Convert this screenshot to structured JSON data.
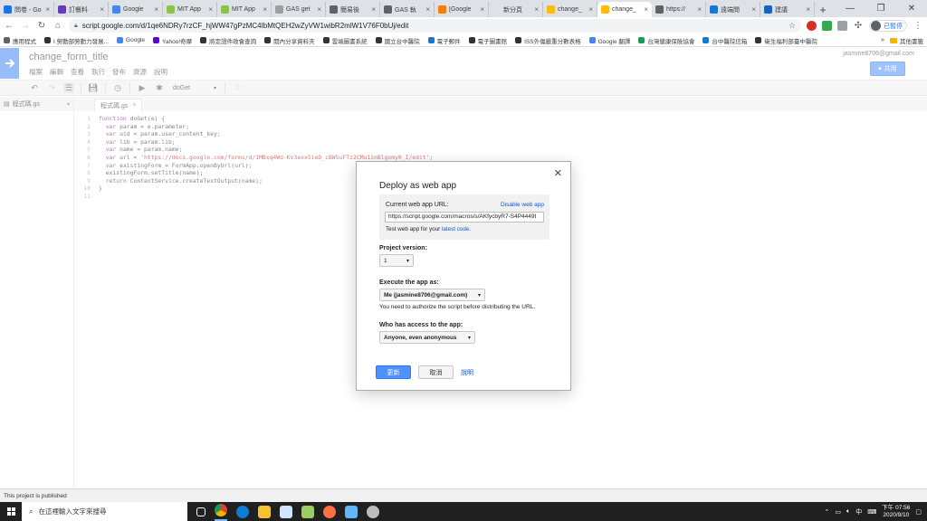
{
  "browser": {
    "tabs": [
      {
        "title": "問卷 - Go",
        "color": "#1a73e8"
      },
      {
        "title": "訂餐料",
        "color": "#673ab7"
      },
      {
        "title": "Google",
        "color": "#4285f4"
      },
      {
        "title": "MIT App",
        "color": "#8bc34a"
      },
      {
        "title": "MIT App",
        "color": "#8bc34a"
      },
      {
        "title": "GAS get",
        "color": "#9e9e9e"
      },
      {
        "title": "簡易後",
        "color": "#5f6368"
      },
      {
        "title": "GAS 執",
        "color": "#5f6368"
      },
      {
        "title": "[Google",
        "color": "#f57c00"
      },
      {
        "title": "新分頁",
        "color": "#dee1e6"
      },
      {
        "title": "change_",
        "color": "#fbbc04"
      },
      {
        "title": "change_",
        "color": "#fbbc04"
      },
      {
        "title": "https://",
        "color": "#5f6368"
      },
      {
        "title": "遠端問",
        "color": "#1976d2"
      },
      {
        "title": "建議",
        "color": "#1565c0"
      }
    ],
    "active_tab_index": 11,
    "url": "script.google.com/d/1qe6NDRy7rzCF_hjWW47gPzMC4IbMtQEH2wZyVW1wibR2mlW1V76F0bUj/edit",
    "profile_label": "已暫停",
    "bookmarks": [
      {
        "label": "應用程式",
        "color": "#5f6368"
      },
      {
        "label": "I 勞動部勞動力發展...",
        "color": "#333333"
      },
      {
        "label": "Google",
        "color": "#4285f4"
      },
      {
        "label": "Yahoo!奇摩",
        "color": "#6001d2"
      },
      {
        "label": "將定證件政會查詢",
        "color": "#333333"
      },
      {
        "label": "開內分享資料夾",
        "color": "#333333"
      },
      {
        "label": "雲端圖書系統",
        "color": "#333333"
      },
      {
        "label": "國立台中醫院",
        "color": "#333333"
      },
      {
        "label": "電子郵件",
        "color": "#1976d2"
      },
      {
        "label": "電子圖書館",
        "color": "#333333"
      },
      {
        "label": "ISS外傷嚴重分數表格",
        "color": "#333333"
      },
      {
        "label": "Google 翻譯",
        "color": "#4285f4"
      },
      {
        "label": "台灣健康保險協會",
        "color": "#0f9d58"
      },
      {
        "label": "台中醫院信箱",
        "color": "#1976d2"
      },
      {
        "label": "衛生福利部臺中醫院",
        "color": "#333333"
      }
    ],
    "bookmarks_more": "»",
    "other_bookmarks": "其他書籤"
  },
  "app": {
    "project_title": "change_form_title",
    "menu": [
      "檔案",
      "編輯",
      "查看",
      "執行",
      "發布",
      "資源",
      "說明"
    ],
    "user_email": "jasmine8706@gmail.com",
    "share_label": "共用",
    "function_select": "doGet",
    "file_name": "程式碼.gs",
    "editor_tab": "程式碼.gs",
    "status": "This project is published"
  },
  "code_lines": [
    "function doGet(e) {",
    "  var param = e.parameter;",
    "  var uid = param.user_content_key;",
    "  var lib = param.lib;",
    "  var name = param.name;",
    "  var url = 'https://docs.google.com/forms/d/1MBxq4Wd-Kv3exx5ieD_cBW5uFTz2CMu1inBlgxmy0_I/edit';",
    "  var existingForm = FormApp.openByUrl(url);",
    "  existingForm.setTitle(name);",
    "  return ContentService.createTextOutput(name);",
    "}",
    ""
  ],
  "dialog": {
    "title": "Deploy as web app",
    "current_url_label": "Current web app URL:",
    "disable_link": "Disable web app",
    "current_url": "https://script.google.com/macros/s/AKfycbyR7-S4P4449t",
    "test_text": "Test web app for your ",
    "test_link": "latest code",
    "test_suffix": ".",
    "project_version_label": "Project version:",
    "project_version": "1",
    "execute_label": "Execute the app as:",
    "execute_value": "Me (jasmine8706@gmail.com)",
    "authorize_note": "You need to authorize the script before distributing the URL.",
    "access_label": "Who has access to the app:",
    "access_value": "Anyone, even anonymous",
    "update_button": "更新",
    "cancel_button": "取消",
    "help_link": "說明"
  },
  "taskbar": {
    "search_placeholder": "在這裡輸入文字來搜尋",
    "time": "下午 07:56",
    "date": "2020/9/10"
  }
}
